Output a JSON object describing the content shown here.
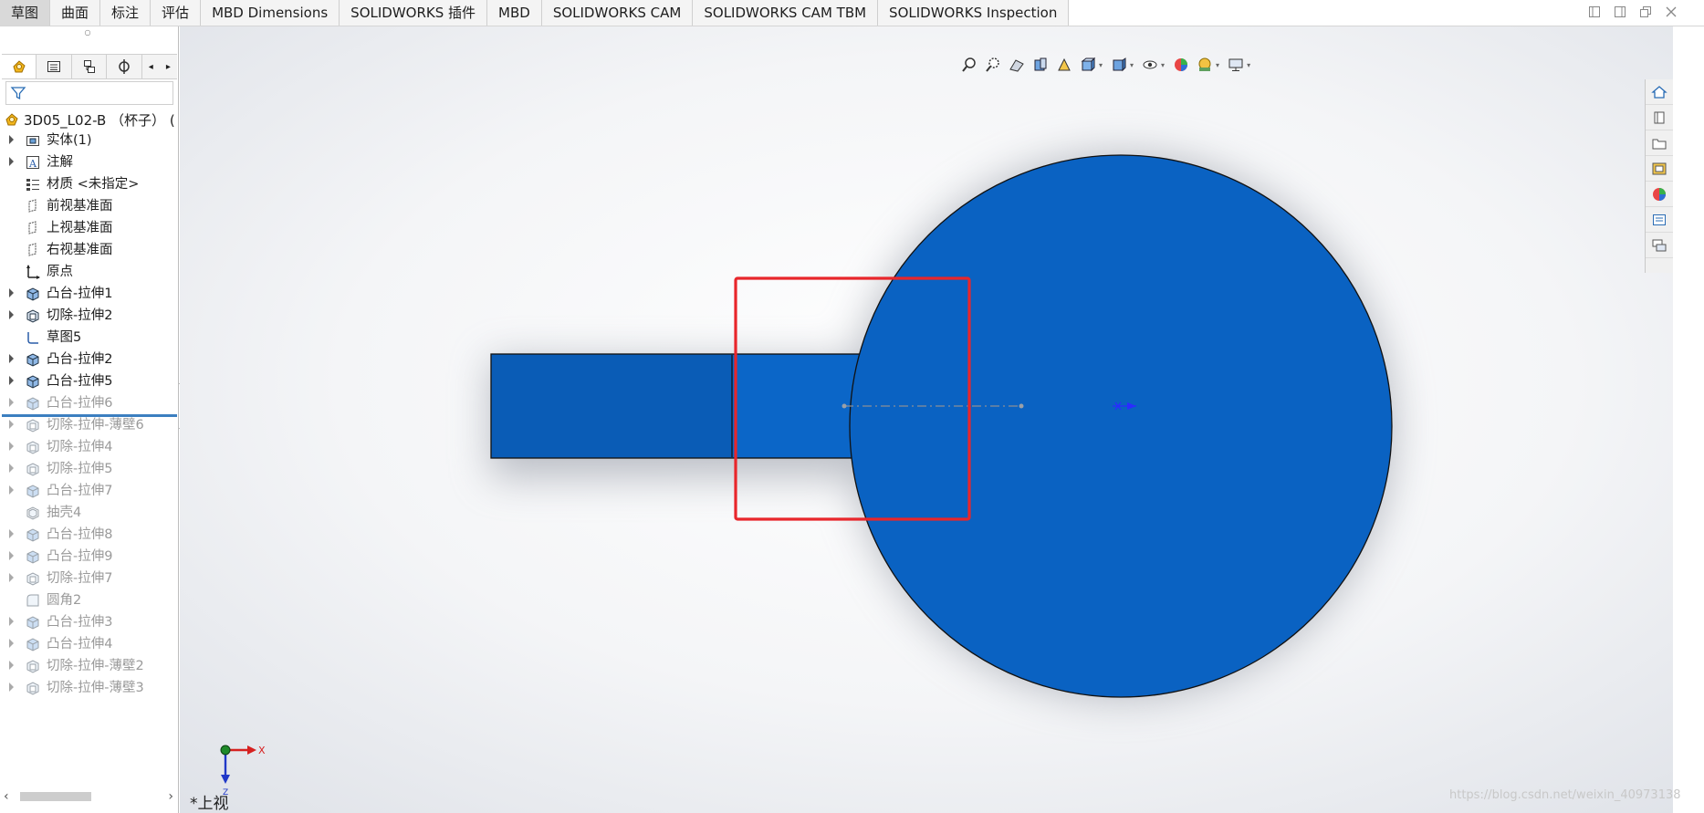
{
  "tabs": [
    {
      "label": "草图",
      "active": true
    },
    {
      "label": "曲面",
      "active": false
    },
    {
      "label": "标注",
      "active": false
    },
    {
      "label": "评估",
      "active": false
    },
    {
      "label": "MBD Dimensions",
      "active": false
    },
    {
      "label": "SOLIDWORKS 插件",
      "active": false
    },
    {
      "label": "MBD",
      "active": false
    },
    {
      "label": "SOLIDWORKS CAM",
      "active": false
    },
    {
      "label": "SOLIDWORKS CAM TBM",
      "active": false
    },
    {
      "label": "SOLIDWORKS Inspection",
      "active": false
    }
  ],
  "tree": {
    "root_label": "3D05_L02-B （杯子）   (",
    "items": [
      {
        "label": "实体(1)",
        "icon": "solid-bodies-icon",
        "arrow": true,
        "dim": false
      },
      {
        "label": "注解",
        "icon": "annotations-icon",
        "arrow": true,
        "dim": false
      },
      {
        "label": "材质 <未指定>",
        "icon": "material-icon",
        "arrow": false,
        "dim": false
      },
      {
        "label": "前视基准面",
        "icon": "plane-icon",
        "arrow": false,
        "dim": false
      },
      {
        "label": "上视基准面",
        "icon": "plane-icon",
        "arrow": false,
        "dim": false
      },
      {
        "label": "右视基准面",
        "icon": "plane-icon",
        "arrow": false,
        "dim": false
      },
      {
        "label": "原点",
        "icon": "origin-icon",
        "arrow": false,
        "dim": false
      },
      {
        "label": "凸台-拉伸1",
        "icon": "boss-extrude-icon",
        "arrow": true,
        "dim": false
      },
      {
        "label": "切除-拉伸2",
        "icon": "cut-extrude-icon",
        "arrow": true,
        "dim": false
      },
      {
        "label": "草图5",
        "icon": "sketch-icon",
        "arrow": false,
        "dim": false
      },
      {
        "label": "凸台-拉伸2",
        "icon": "boss-extrude-icon",
        "arrow": true,
        "dim": false
      },
      {
        "label": "凸台-拉伸5",
        "icon": "boss-extrude-icon",
        "arrow": true,
        "dim": false
      },
      {
        "label": "凸台-拉伸6",
        "icon": "boss-extrude-icon",
        "arrow": true,
        "dim": true
      },
      {
        "label": "切除-拉伸-薄壁6",
        "icon": "cut-extrude-icon",
        "arrow": true,
        "dim": true
      },
      {
        "label": "切除-拉伸4",
        "icon": "cut-extrude-icon",
        "arrow": true,
        "dim": true
      },
      {
        "label": "切除-拉伸5",
        "icon": "cut-extrude-icon",
        "arrow": true,
        "dim": true
      },
      {
        "label": "凸台-拉伸7",
        "icon": "boss-extrude-icon",
        "arrow": true,
        "dim": true
      },
      {
        "label": "抽壳4",
        "icon": "shell-icon",
        "arrow": false,
        "dim": true
      },
      {
        "label": "凸台-拉伸8",
        "icon": "boss-extrude-icon",
        "arrow": true,
        "dim": true
      },
      {
        "label": "凸台-拉伸9",
        "icon": "boss-extrude-icon",
        "arrow": true,
        "dim": true
      },
      {
        "label": "切除-拉伸7",
        "icon": "cut-extrude-icon",
        "arrow": true,
        "dim": true
      },
      {
        "label": "圆角2",
        "icon": "fillet-icon",
        "arrow": false,
        "dim": true
      },
      {
        "label": "凸台-拉伸3",
        "icon": "boss-extrude-icon",
        "arrow": true,
        "dim": true
      },
      {
        "label": "凸台-拉伸4",
        "icon": "boss-extrude-icon",
        "arrow": true,
        "dim": true
      },
      {
        "label": "切除-拉伸-薄壁2",
        "icon": "cut-extrude-icon",
        "arrow": true,
        "dim": true
      },
      {
        "label": "切除-拉伸-薄壁3",
        "icon": "cut-extrude-icon",
        "arrow": true,
        "dim": true
      }
    ]
  },
  "viewport": {
    "view_label": "*上视",
    "triad_x": "X",
    "triad_z": "Z",
    "watermark": "https://blog.csdn.net/weixin_40973138",
    "part_color": "#0a62c2",
    "highlight_color": "#e8262b"
  }
}
